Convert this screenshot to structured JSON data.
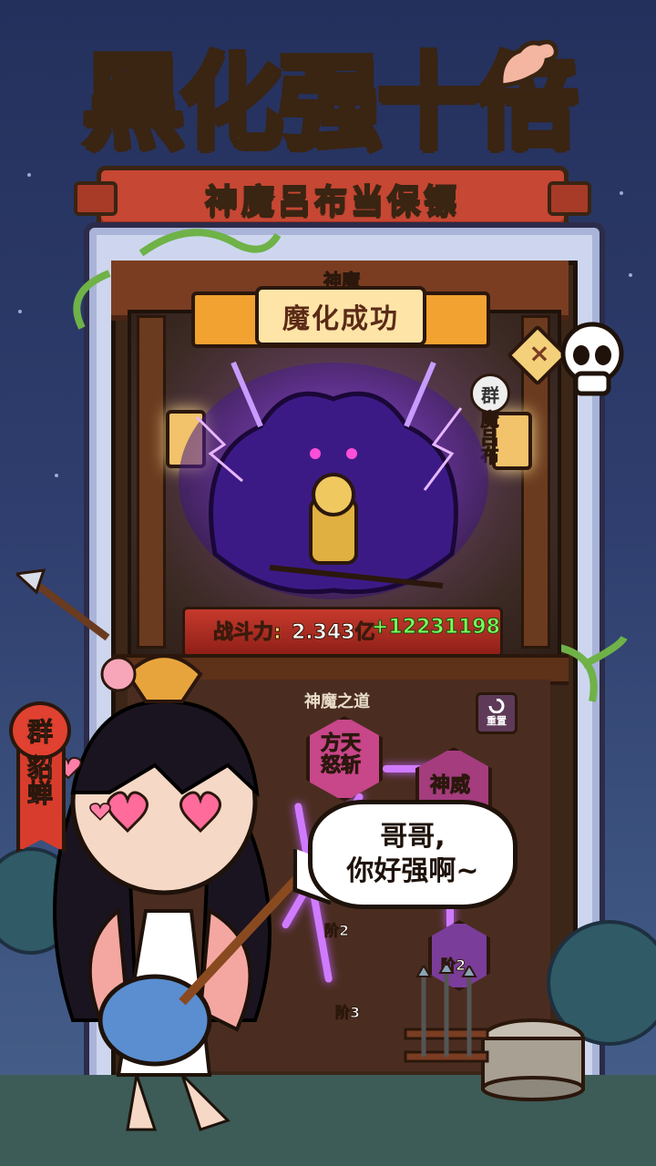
{
  "title": "黑化强十倍",
  "ribbon_text": "神魔吕布当保镖",
  "stage": {
    "category": "神魔",
    "result_banner": "魔化成功",
    "close_icon": "×",
    "hero_faction": "群",
    "hero_name": "魔吕布",
    "power_label": "战斗力:",
    "power_value": "2.343亿",
    "power_delta": "+12231198"
  },
  "path": {
    "title": "神魔之道",
    "reset_label": "重置",
    "nodes": [
      {
        "label": "方天\n怒斩"
      },
      {
        "label": "神威"
      }
    ],
    "tiers": [
      "阶2",
      "阶3",
      "阶2"
    ]
  },
  "companion": {
    "faction": "群",
    "name": "貂蝉",
    "speech_line1": "哥哥,",
    "speech_line2": "你好强啊~"
  },
  "colors": {
    "title_yellow": "#ffe94a",
    "outline_brown": "#3a2412",
    "ribbon_red": "#c64733",
    "demon_purple": "#7a3cd6",
    "power_green": "#7cff5a"
  }
}
